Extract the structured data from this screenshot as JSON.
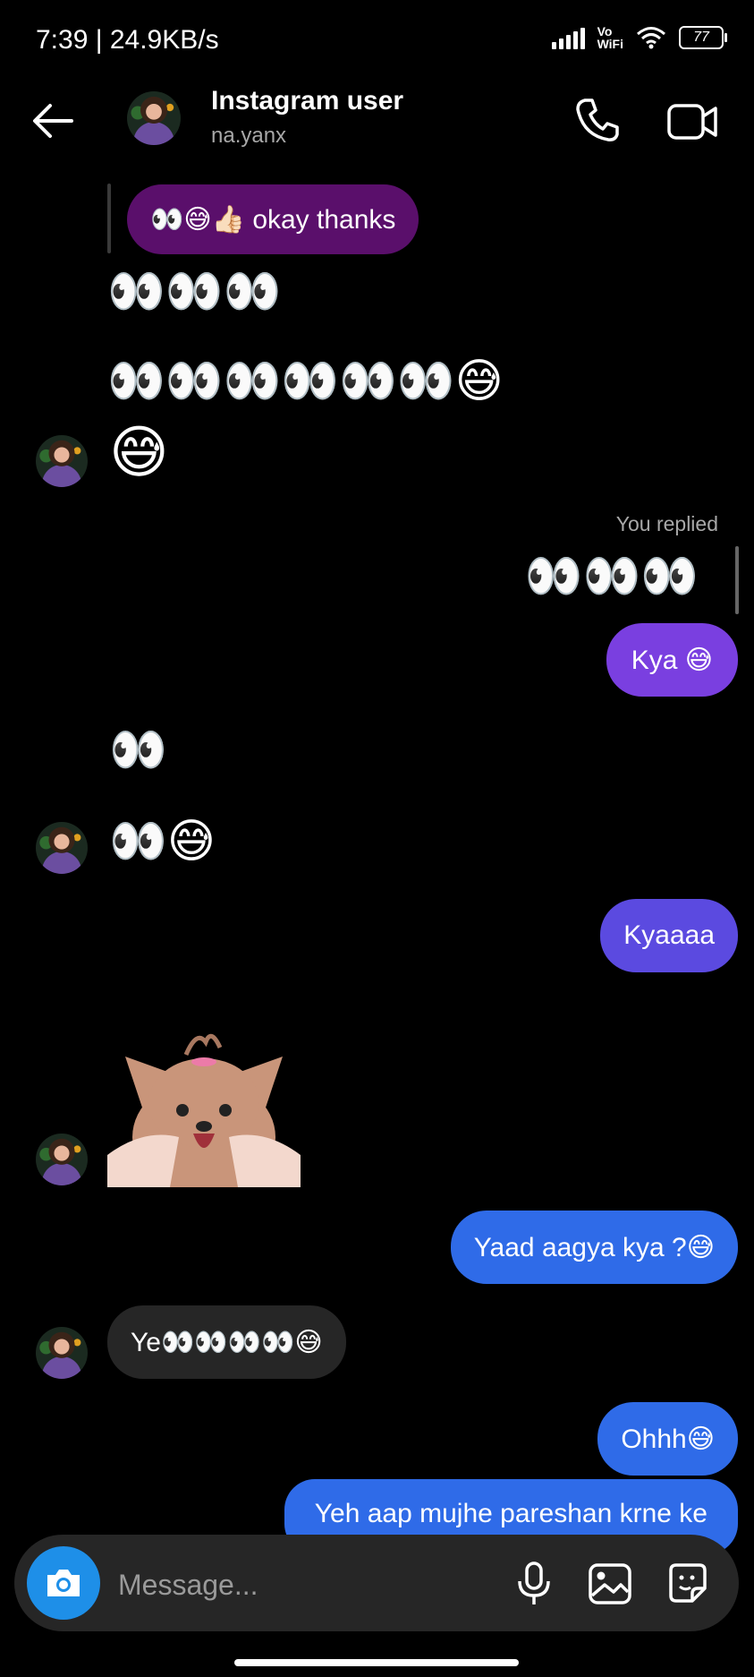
{
  "status": {
    "time": "7:39 | 24.9KB/s",
    "network_label_top": "Vo",
    "network_label_bottom": "WiFi",
    "battery": "77"
  },
  "header": {
    "name": "Instagram user",
    "username": "na.yanx",
    "icons": [
      "back-arrow-icon",
      "phone-icon",
      "video-camera-icon"
    ]
  },
  "messages": {
    "m1": "👀😅👍🏻 okay thanks",
    "m2": "👀👀👀",
    "m3": "👀👀👀👀👀👀😅",
    "m4": "😅",
    "you_replied": "You replied",
    "m5_quote": "👀👀👀",
    "m6": "Kya 😅",
    "m7": "👀",
    "m8": "👀😅",
    "m9": "Kyaaaa",
    "m10": "Yaad aagya kya ?😅",
    "m11": "Ye👀👀👀👀😅",
    "m12": "Ohhh😅",
    "m13": "Yeh aap mujhe pareshan krne ke"
  },
  "composer": {
    "placeholder": "Message..."
  },
  "colors": {
    "bubble_purple_dark": "#5a0f6b",
    "bubble_violet": "#7a3fe0",
    "bubble_indigo": "#5b4ae0",
    "bubble_blue": "#2f6be8",
    "bubble_incoming": "#262626",
    "camera_blue": "#1e8fe8"
  }
}
